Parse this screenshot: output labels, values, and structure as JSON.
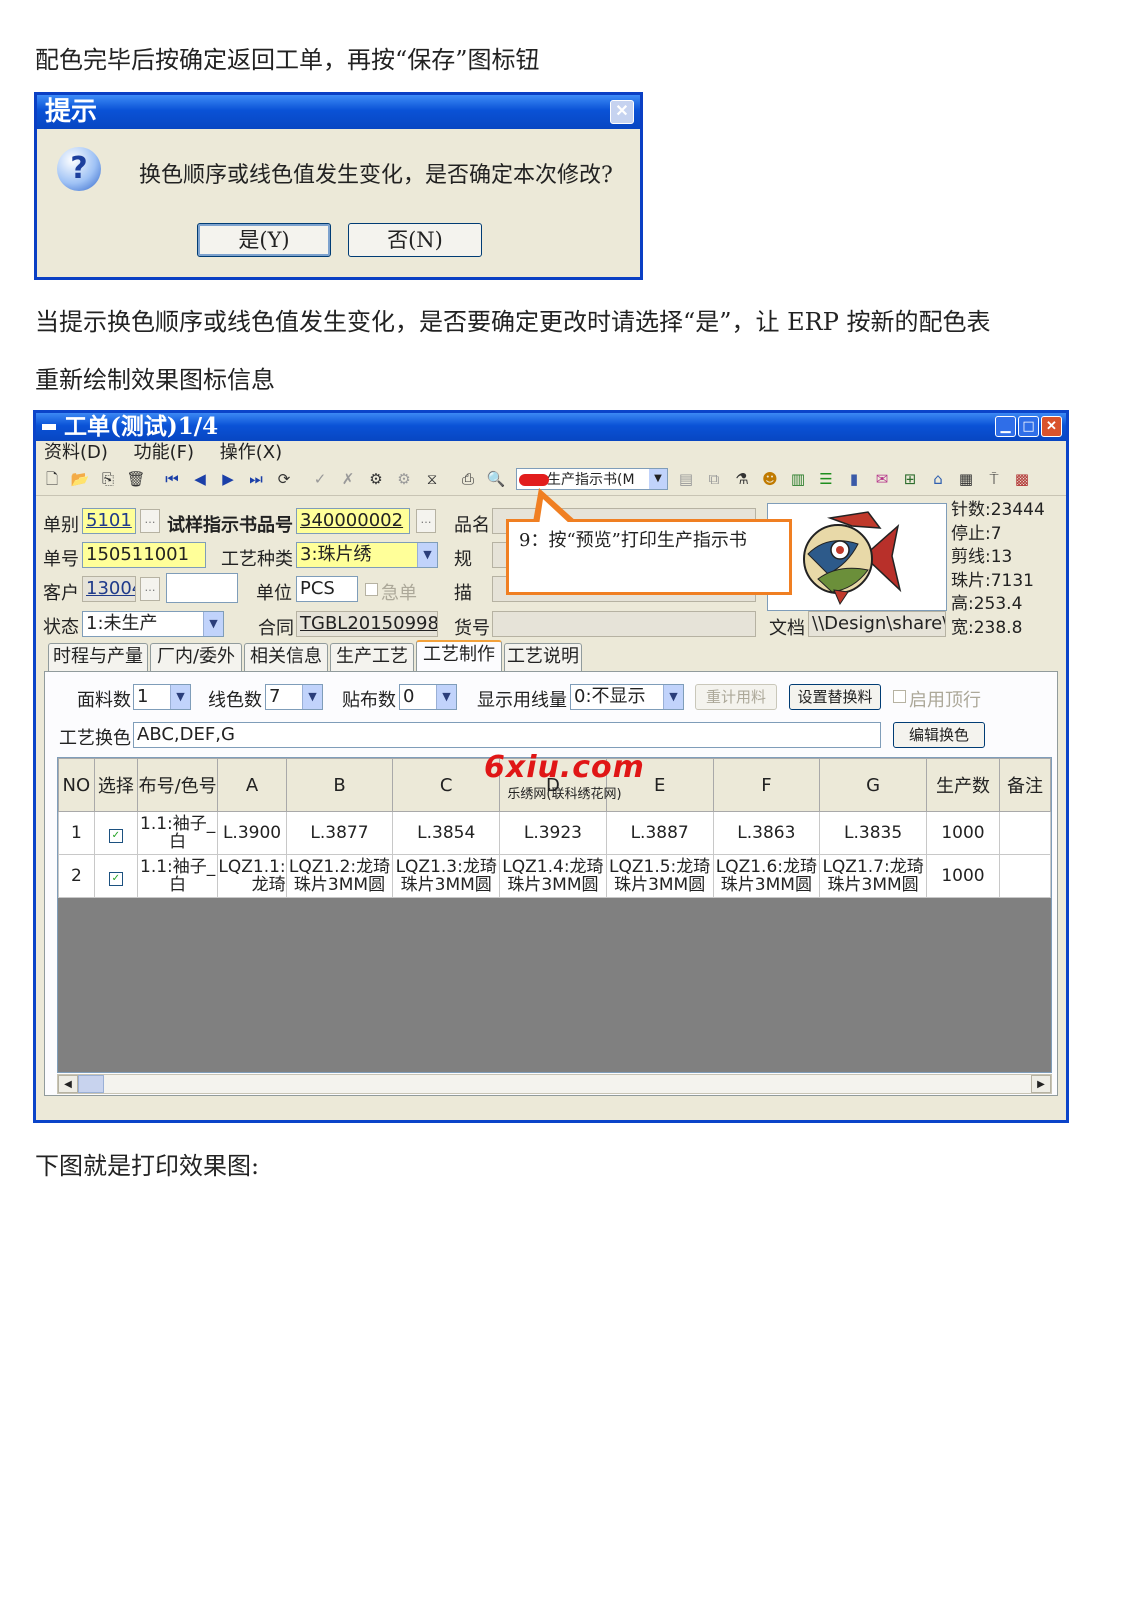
{
  "intro_text": "配色完毕后按确定返回工单，再按“保存”图标钮",
  "dialog": {
    "title": "提示",
    "message": "换色顺序或线色值发生变化，是否确定本次修改?",
    "yes_label": "是(Y)",
    "no_label": "否(N)"
  },
  "explain_line1": "当提示换色顺序或线色值发生变化，是否要确定更改时请选择“是”，让 ERP 按新的配色表",
  "explain_line2": "重新绘制效果图标信息",
  "window": {
    "title": "工单(测试)1/4",
    "menu": [
      "资料(D)",
      "功能(F)",
      "操作(X)"
    ],
    "toolbar_select": "生产指示书(M"
  },
  "form": {
    "danbie_label": "单别",
    "danbie_value": "5101",
    "shiyang_label": "试样指示书品号",
    "shiyang_value": "340000002",
    "pinming_label": "品名",
    "danhao_label": "单号",
    "danhao_value": "150511001",
    "gongyi_label": "工艺种类",
    "gongyi_value": "3:珠片绣",
    "gui_label": "规",
    "kehu_label": "客户",
    "kehu_value": "13004",
    "danwei_label": "单位",
    "danwei_value": "PCS",
    "jidan_label": "急单",
    "miao_label": "描",
    "zhuangtai_label": "状态",
    "zhuangtai_value": "1:未生产",
    "hetong_label": "合同",
    "hetong_value": "TGBL20150998",
    "huohao_label": "货号",
    "wendang_label": "文档",
    "wendang_value": "\\\\Design\\share\\"
  },
  "stats": [
    "针数:23444",
    "停止:7",
    "剪线:13",
    "珠片:7131",
    "高:253.4",
    "宽:238.8"
  ],
  "tabs": [
    "时程与产量",
    "厂内/委外",
    "相关信息",
    "生产工艺",
    "工艺制作",
    "工艺说明"
  ],
  "panel": {
    "mianliao_label": "面料数",
    "mianliao_value": "1",
    "xianse_label": "线色数",
    "xianse_value": "7",
    "tiebu_label": "贴布数",
    "tiebu_value": "0",
    "xianshi_label": "显示用线量",
    "xianshi_value": "0:不显示",
    "recalc_label": "重计用料",
    "setsub_label": "设置替换料",
    "enable_label": "启用顶行",
    "huanse_label": "工艺换色",
    "huanse_value": "ABC,DEF,G",
    "edit_label": "编辑换色"
  },
  "grid": {
    "headers": [
      "NO",
      "选择",
      "布号/色号",
      "A",
      "B",
      "C",
      "D",
      "E",
      "F",
      "G",
      "生产数",
      "备注"
    ],
    "rows": [
      [
        "1",
        "✓",
        "1.1:袖子_白",
        "L.3900",
        "L.3877",
        "L.3854",
        "L.3923",
        "L.3887",
        "L.3863",
        "L.3835",
        "1000",
        ""
      ],
      [
        "2",
        "✓",
        "1.1:袖子_白",
        "LQZ1.1:龙琦",
        "LQZ1.2:龙琦珠片3MM圆",
        "LQZ1.3:龙琦珠片3MM圆",
        "LQZ1.4:龙琦珠片3MM圆",
        "LQZ1.5:龙琦珠片3MM圆",
        "LQZ1.6:龙琦珠片3MM圆",
        "LQZ1.7:龙琦珠片3MM圆",
        "1000",
        ""
      ]
    ]
  },
  "callout_text": "9：按“预览”打印生产指示书",
  "watermark": {
    "brand": "6xiu.com",
    "sub": "乐绣网(联科绣花网)"
  },
  "outro_text": "下图就是打印效果图:",
  "colors": {
    "title_bar": "#0a52d6",
    "callout_border": "#f07f22",
    "highlight_field": "#ffff99",
    "watermark": "#e01616"
  }
}
